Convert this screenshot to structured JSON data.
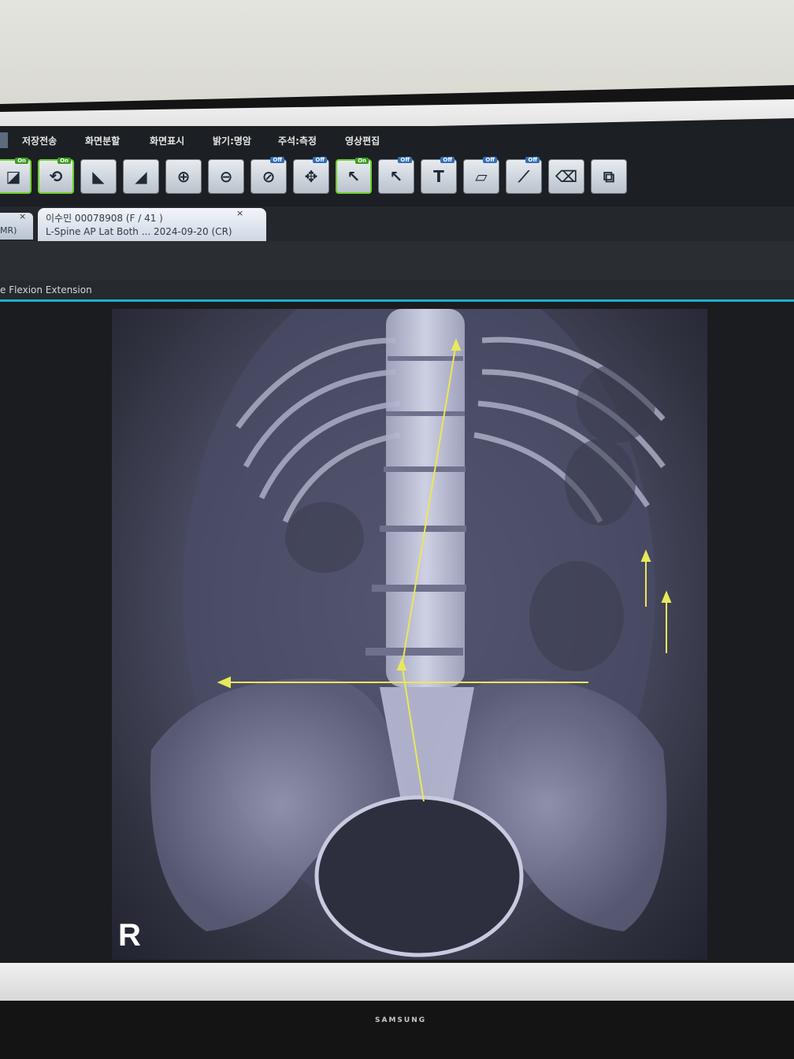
{
  "menu": {
    "items": [
      "저장전송",
      "화면분할",
      "화면표시",
      "밝기:명암",
      "주석:측정",
      "영상편집"
    ]
  },
  "toolbar": {
    "tools": [
      {
        "icon": "window-level-icon",
        "state": "On"
      },
      {
        "icon": "rotate-icon",
        "state": "On"
      },
      {
        "icon": "flip-icon",
        "state": ""
      },
      {
        "icon": "invert-icon",
        "state": ""
      },
      {
        "icon": "zoom-in-icon",
        "state": ""
      },
      {
        "icon": "zoom-out-icon",
        "state": ""
      },
      {
        "icon": "magnifier-icon",
        "state": "Off"
      },
      {
        "icon": "pan-icon",
        "state": "Off"
      },
      {
        "icon": "arrow-icon",
        "state": "On"
      },
      {
        "icon": "text-arrow-icon",
        "state": "Off"
      },
      {
        "icon": "text-icon",
        "state": "Off"
      },
      {
        "icon": "ruler-icon",
        "state": "Off"
      },
      {
        "icon": "line-icon",
        "state": "Off"
      },
      {
        "icon": "eraser-icon",
        "state": ""
      },
      {
        "icon": "network-icon",
        "state": ""
      }
    ]
  },
  "tabs": {
    "left_stub": "MR)",
    "active": {
      "line1": "이수민 00078908 (F / 41 )",
      "line2": "L-Spine AP Lat Both ... 2024-09-20 (CR)"
    }
  },
  "series": {
    "label": "e Flexion Extension"
  },
  "image": {
    "orientation_marker": "R",
    "annotation_color": "#e8e85a"
  },
  "monitor": {
    "brand": "SAMSUNG"
  }
}
